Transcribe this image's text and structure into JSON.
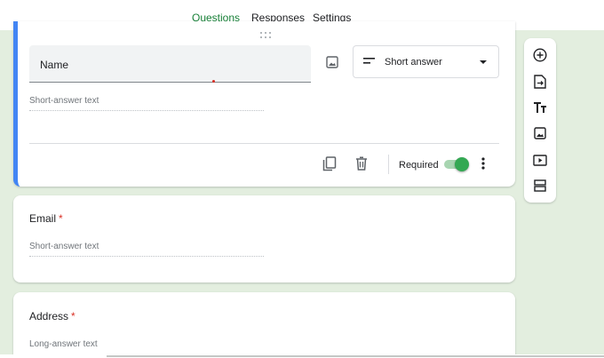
{
  "tabs": [
    {
      "label": "Questions",
      "active": true
    },
    {
      "label": "Responses",
      "active": false
    },
    {
      "label": "Settings",
      "active": false
    }
  ],
  "colors": {
    "accent": "#188038",
    "active_border": "#4285f4",
    "required": "#d93025",
    "background": "#e3eedf"
  },
  "active_question": {
    "title": "Name",
    "answer_type": "Short answer",
    "answer_placeholder": "Short-answer text",
    "required_label": "Required",
    "required_on": true,
    "icons": [
      "drag-handle-icon",
      "image-icon",
      "short-answer-icon",
      "dropdown-arrow-icon",
      "duplicate-icon",
      "delete-icon",
      "more-options-icon"
    ]
  },
  "questions": [
    {
      "title": "Email",
      "required_mark": "*",
      "answer_placeholder": "Short-answer text"
    },
    {
      "title": "Address",
      "required_mark": "*",
      "answer_placeholder": "Long-answer text"
    }
  ],
  "toolbar": {
    "icons": [
      "add-question-icon",
      "import-questions-icon",
      "add-title-icon",
      "add-image-icon",
      "add-video-icon",
      "add-section-icon"
    ]
  }
}
